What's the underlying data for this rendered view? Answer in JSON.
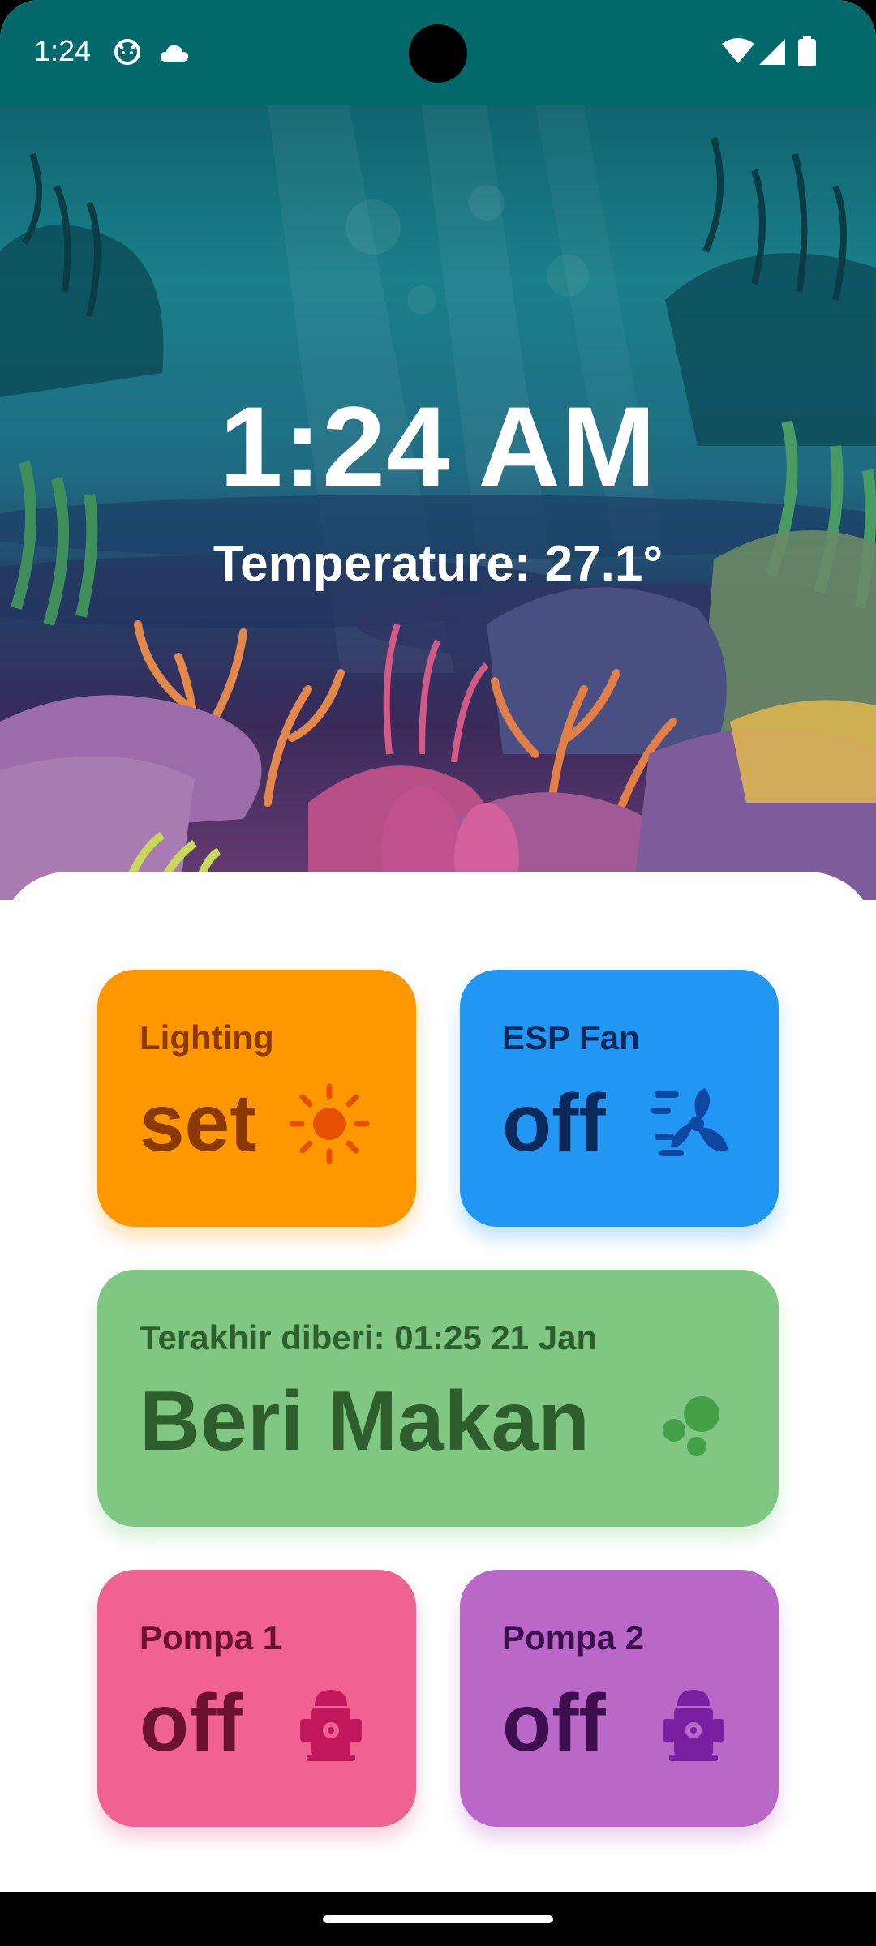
{
  "status_bar": {
    "time": "1:24",
    "icons": [
      "cat-face-icon",
      "cloud-icon",
      "wifi-icon",
      "signal-icon",
      "battery-icon"
    ]
  },
  "hero": {
    "clock": "1:24 AM",
    "temperature": "Temperature: 27.1°"
  },
  "cards": {
    "lighting": {
      "label": "Lighting",
      "value": "set",
      "icon": "sun-icon",
      "color": "#ff9800",
      "text_color": "#8a3a00"
    },
    "fan": {
      "label": "ESP Fan",
      "value": "off",
      "icon": "fan-icon",
      "color": "#2196f3",
      "text_color": "#0b2a5c"
    },
    "feed": {
      "label": "Terakhir diberi: 01:25 21 Jan",
      "value": "Beri Makan",
      "icon": "food-pellets-icon",
      "color": "#81c784",
      "text_color": "#2e5e2b"
    },
    "pump1": {
      "label": "Pompa 1",
      "value": "off",
      "icon": "pump-icon",
      "color": "#f06292",
      "text_color": "#6a1230"
    },
    "pump2": {
      "label": "Pompa 2",
      "value": "off",
      "icon": "pump-icon",
      "color": "#ba68c8",
      "text_color": "#3d0f4f"
    }
  }
}
